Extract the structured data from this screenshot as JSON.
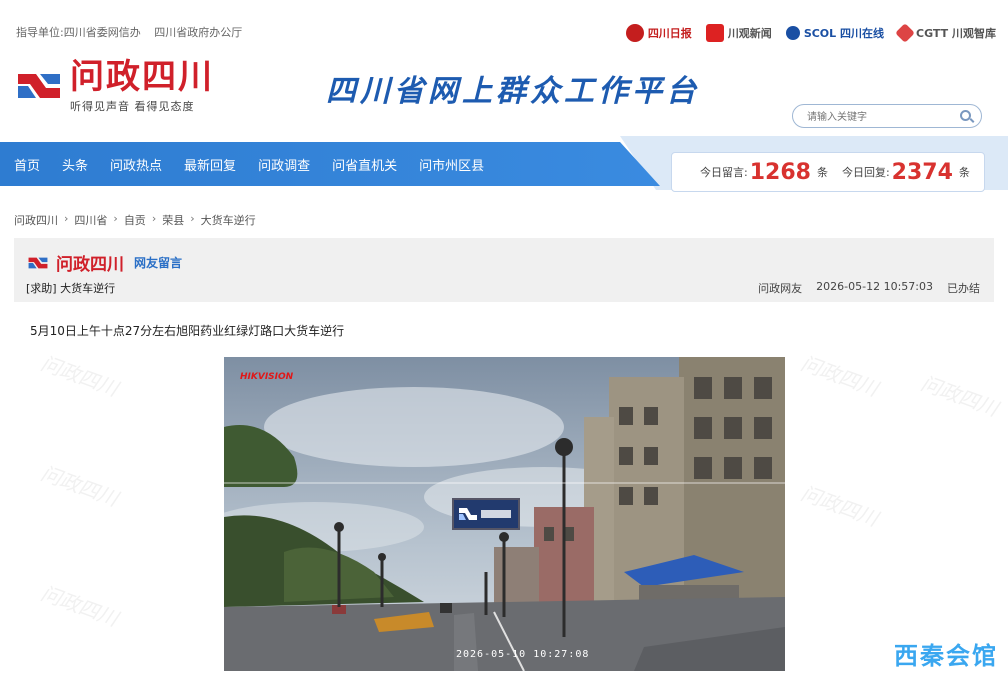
{
  "header": {
    "guide_label": "指导单位:四川省委网信办",
    "guide_label2": "四川省政府办公厅",
    "partners": [
      "四川日报",
      "川观新闻",
      "SCOL 四川在线",
      "CGTT 川观智库"
    ],
    "logo_title": "问政四川",
    "logo_sub": "听得见声音   看得见态度",
    "slogan": "四川省网上群众工作平台",
    "search_placeholder": "请输入关键字"
  },
  "nav": {
    "items": [
      "首页",
      "头条",
      "问政热点",
      "最新回复",
      "问政调查",
      "问省直机关",
      "问市州区县"
    ]
  },
  "stats": {
    "today_messages_label": "今日留言:",
    "today_messages": "1268",
    "today_messages_unit": "条",
    "today_replies_label": "今日回复:",
    "today_replies": "2374",
    "today_replies_unit": "条"
  },
  "breadcrumb": [
    "问政四川",
    "四川省",
    "自贡",
    "荣县",
    "大货车逆行"
  ],
  "post": {
    "brand": "问政四川",
    "tag": "网友留言",
    "title": "[求助] 大货车逆行",
    "author": "问政网友",
    "datetime": "2026-05-12 10:57:03",
    "status": "已办结",
    "body": "5月10日上午十点27分左右旭阳药业红绿灯路口大货车逆行"
  },
  "image": {
    "camera_brand": "HIKVISION",
    "timestamp": "2026-05-10 10:27:08"
  },
  "corner_watermark": "西秦会馆",
  "colors": {
    "brand_red": "#d0202a",
    "nav_blue": "#2f7fd3",
    "stat_red": "#d8322f",
    "watermark_blue": "#3aa7f0"
  }
}
